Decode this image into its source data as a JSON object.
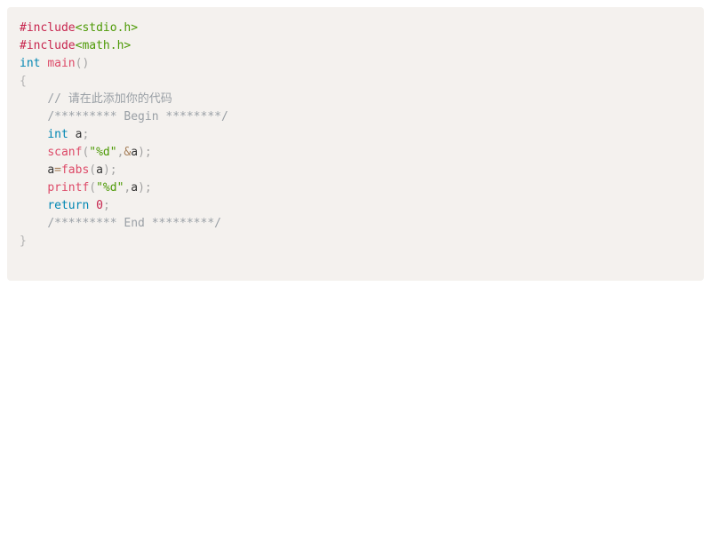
{
  "editor": {
    "language": "c",
    "background_color": "#f4f1ee",
    "page_background_color": "#ffffff",
    "colors": {
      "preprocessor": "#c7254e",
      "header": "#4d9a06",
      "string": "#4d9a06",
      "keyword": "#0086b3",
      "function": "#dd4a68",
      "number": "#c7254e",
      "punctuation": "#a3a3a3",
      "operator": "#a67f59",
      "identifier": "#333333",
      "comment": "#9aa0a6"
    }
  },
  "code": {
    "lines": [
      {
        "index": 1,
        "text": "#include<stdio.h>",
        "tokens": [
          {
            "t": "#include",
            "c": "t-pre"
          },
          {
            "t": "<stdio.h>",
            "c": "t-inc"
          }
        ]
      },
      {
        "index": 2,
        "text": "#include<math.h>",
        "tokens": [
          {
            "t": "#include",
            "c": "t-pre"
          },
          {
            "t": "<math.h>",
            "c": "t-inc"
          }
        ]
      },
      {
        "index": 3,
        "text": "int main()",
        "tokens": [
          {
            "t": "int",
            "c": "t-kw"
          },
          {
            "t": " ",
            "c": "t-id"
          },
          {
            "t": "main",
            "c": "t-fn"
          },
          {
            "t": "()",
            "c": "t-punc"
          }
        ]
      },
      {
        "index": 4,
        "text": "{",
        "tokens": [
          {
            "t": "{",
            "c": "t-brace"
          }
        ]
      },
      {
        "index": 5,
        "text": "    // 请在此添加你的代码",
        "tokens": [
          {
            "t": "    ",
            "c": "t-id"
          },
          {
            "t": "// 请在此添加你的代码",
            "c": "t-cmt"
          }
        ]
      },
      {
        "index": 6,
        "text": "    /********* Begin ********/",
        "tokens": [
          {
            "t": "    ",
            "c": "t-id"
          },
          {
            "t": "/********* Begin ********/",
            "c": "t-cmt"
          }
        ]
      },
      {
        "index": 7,
        "text": "    int a;",
        "tokens": [
          {
            "t": "    ",
            "c": "t-id"
          },
          {
            "t": "int",
            "c": "t-kw"
          },
          {
            "t": " ",
            "c": "t-id"
          },
          {
            "t": "a",
            "c": "t-id"
          },
          {
            "t": ";",
            "c": "t-punc"
          }
        ]
      },
      {
        "index": 8,
        "text": "    scanf(\"%d\",&a);",
        "tokens": [
          {
            "t": "    ",
            "c": "t-id"
          },
          {
            "t": "scanf",
            "c": "t-fn"
          },
          {
            "t": "(",
            "c": "t-punc"
          },
          {
            "t": "\"%d\"",
            "c": "t-str"
          },
          {
            "t": ",",
            "c": "t-punc"
          },
          {
            "t": "&",
            "c": "t-op"
          },
          {
            "t": "a",
            "c": "t-id"
          },
          {
            "t": ");",
            "c": "t-punc"
          }
        ]
      },
      {
        "index": 9,
        "text": "    a=fabs(a);",
        "tokens": [
          {
            "t": "    ",
            "c": "t-id"
          },
          {
            "t": "a",
            "c": "t-id"
          },
          {
            "t": "=",
            "c": "t-op"
          },
          {
            "t": "fabs",
            "c": "t-fn"
          },
          {
            "t": "(",
            "c": "t-punc"
          },
          {
            "t": "a",
            "c": "t-id"
          },
          {
            "t": ");",
            "c": "t-punc"
          }
        ]
      },
      {
        "index": 10,
        "text": "    printf(\"%d\",a);",
        "tokens": [
          {
            "t": "    ",
            "c": "t-id"
          },
          {
            "t": "printf",
            "c": "t-fn"
          },
          {
            "t": "(",
            "c": "t-punc"
          },
          {
            "t": "\"%d\"",
            "c": "t-str"
          },
          {
            "t": ",",
            "c": "t-punc"
          },
          {
            "t": "a",
            "c": "t-id"
          },
          {
            "t": ");",
            "c": "t-punc"
          }
        ]
      },
      {
        "index": 11,
        "text": "    return 0;",
        "tokens": [
          {
            "t": "    ",
            "c": "t-id"
          },
          {
            "t": "return",
            "c": "t-kw"
          },
          {
            "t": " ",
            "c": "t-id"
          },
          {
            "t": "0",
            "c": "t-num"
          },
          {
            "t": ";",
            "c": "t-punc"
          }
        ]
      },
      {
        "index": 12,
        "text": "    /********* End *********/",
        "tokens": [
          {
            "t": "    ",
            "c": "t-id"
          },
          {
            "t": "/********* End *********/",
            "c": "t-cmt"
          }
        ]
      },
      {
        "index": 13,
        "text": "}",
        "tokens": [
          {
            "t": "}",
            "c": "t-brace"
          }
        ]
      }
    ]
  }
}
